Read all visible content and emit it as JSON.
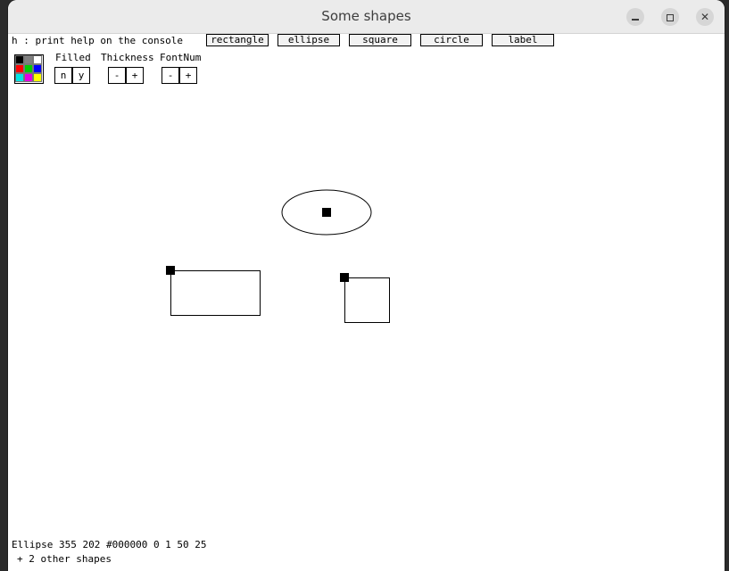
{
  "window": {
    "title": "Some shapes"
  },
  "toolbar": {
    "help_text": "h : print help on the console",
    "shape_buttons": [
      "rectangle",
      "ellipse",
      "square",
      "circle",
      "label"
    ]
  },
  "palette": {
    "colors": [
      "#000000",
      "#808080",
      "#ffffff",
      "#ff0000",
      "#00cc00",
      "#0000ff",
      "#00e5e5",
      "#e500e5",
      "#ffff00"
    ]
  },
  "controls": {
    "filled": {
      "label": "Filled",
      "no": "n",
      "yes": "y"
    },
    "thickness": {
      "label": "Thickness",
      "minus": "-",
      "plus": "+"
    },
    "fontnum": {
      "label": "FontNum",
      "minus": "-",
      "plus": "+"
    }
  },
  "status": {
    "line1": "Ellipse 355 202 #000000 0 1 50 25",
    "line2": "+ 2 other shapes"
  }
}
